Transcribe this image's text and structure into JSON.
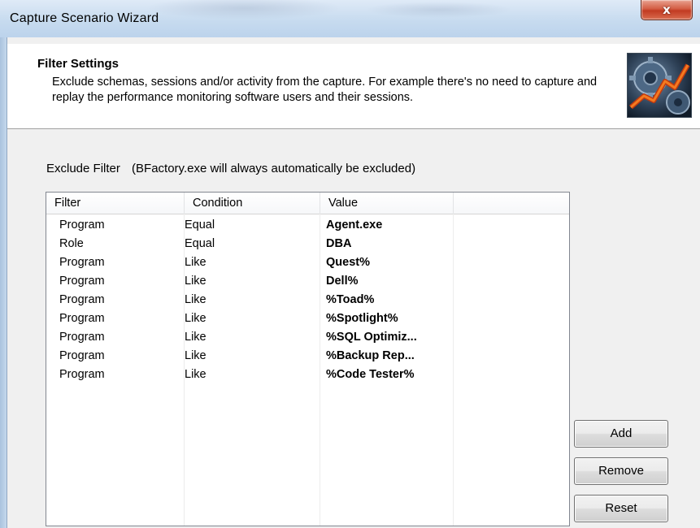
{
  "window": {
    "title": "Capture Scenario Wizard",
    "close_glyph": "x"
  },
  "header": {
    "title": "Filter Settings",
    "description": "Exclude schemas, sessions and/or activity from the capture. For example there's no need to capture and replay the performance monitoring software users and their sessions."
  },
  "exclude": {
    "label": "Exclude Filter",
    "note": "(BFactory.exe will always automatically be excluded)"
  },
  "table": {
    "columns": [
      "Filter",
      "Condition",
      "Value"
    ],
    "rows": [
      {
        "filter": "Program",
        "condition": "Equal",
        "value": "Agent.exe"
      },
      {
        "filter": "Role",
        "condition": "Equal",
        "value": "DBA"
      },
      {
        "filter": "Program",
        "condition": "Like",
        "value": "Quest%"
      },
      {
        "filter": "Program",
        "condition": "Like",
        "value": "Dell%"
      },
      {
        "filter": "Program",
        "condition": "Like",
        "value": "%Toad%"
      },
      {
        "filter": "Program",
        "condition": "Like",
        "value": "%Spotlight%"
      },
      {
        "filter": "Program",
        "condition": "Like",
        "value": "%SQL Optimiz..."
      },
      {
        "filter": "Program",
        "condition": "Like",
        "value": "%Backup Rep..."
      },
      {
        "filter": "Program",
        "condition": "Like",
        "value": "%Code Tester%"
      }
    ]
  },
  "buttons": {
    "add": "Add",
    "remove": "Remove",
    "reset": "Reset"
  },
  "icons": {
    "close": "close-icon",
    "logo": "performance-chart-gears-icon"
  },
  "colors": {
    "close_red": "#c23b22",
    "title_bar": "#c7dbef",
    "dialog_bg": "#f0f0f0"
  }
}
